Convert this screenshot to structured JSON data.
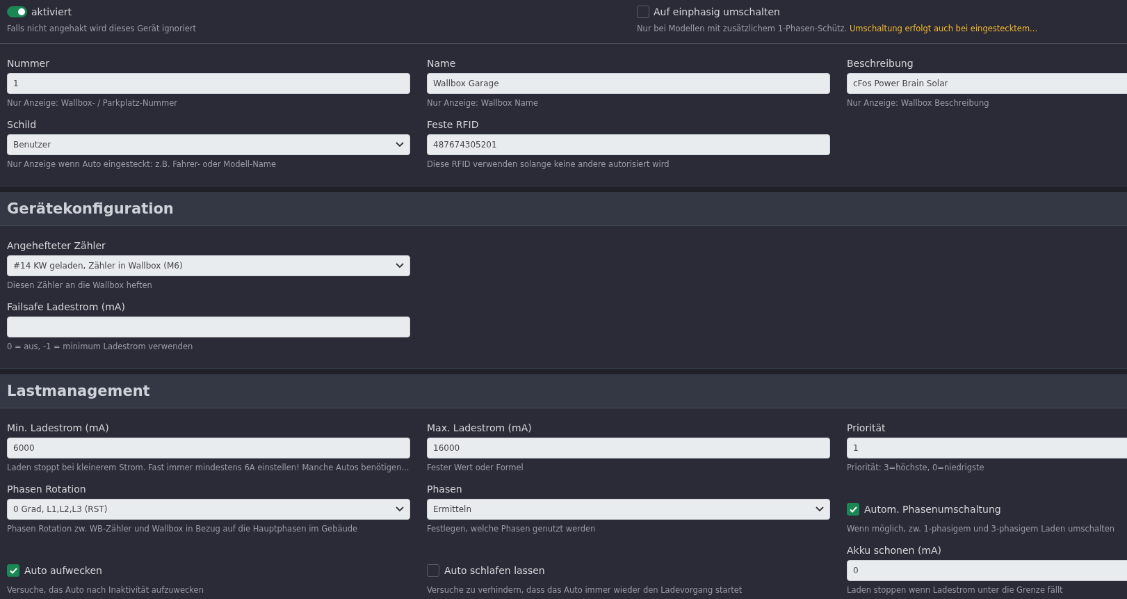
{
  "top_options": [
    {
      "kind": "switch",
      "label": "aktiviert",
      "checked": true,
      "hint": "Falls nicht angehakt wird dieses Gerät ignoriert"
    },
    {
      "kind": "checkbox",
      "label": "Auf einphasig umschalten",
      "checked": false,
      "hint": "Nur bei Modellen mit zusätzlichem 1-Phasen-Schütz.",
      "warning": "Umschaltung erfolgt auch bei eingestecktem..."
    }
  ],
  "general": {
    "rows": [
      [
        {
          "kind": "input",
          "label": "Nummer",
          "value": "1",
          "hint": "Nur Anzeige: Wallbox- / Parkplatz-Nummer"
        },
        {
          "kind": "input",
          "label": "Name",
          "value": "Wallbox Garage",
          "hint": "Nur Anzeige: Wallbox Name"
        },
        {
          "kind": "input",
          "label": "Beschreibung",
          "value": "cFos Power Brain Solar",
          "hint": "Nur Anzeige: Wallbox Beschreibung"
        }
      ],
      [
        {
          "kind": "select",
          "label": "Schild",
          "value": "Benutzer",
          "hint": "Nur Anzeige wenn Auto eingesteckt: z.B. Fahrer- oder Modell-Name"
        },
        {
          "kind": "input",
          "label": "Feste RFID",
          "value": "487674305201",
          "hint": "Diese RFID verwenden solange keine andere autorisiert wird"
        }
      ]
    ]
  },
  "sections": [
    {
      "title": "Gerätekonfiguration",
      "rows": [
        [
          {
            "kind": "select",
            "label": "Angehefteter Zähler",
            "value": "#14 KW geladen, Zähler in Wallbox (M6)",
            "hint": "Diesen Zähler an die Wallbox heften"
          }
        ],
        [
          {
            "kind": "input",
            "label": "Failsafe Ladestrom (mA)",
            "hint": "0 = aus, -1 = minimum Ladestrom verwenden"
          }
        ]
      ]
    },
    {
      "title": "Lastmanagement",
      "rows": [
        [
          {
            "kind": "input",
            "label": "Min. Ladestrom (mA)",
            "value": "6000",
            "hint": "Laden stoppt bei kleinerem Strom. Fast immer mindestens 6A einstellen! Manche Autos benötigen..."
          },
          {
            "kind": "input",
            "label": "Max. Ladestrom (mA)",
            "value": "16000",
            "hint": "Fester Wert oder Formel"
          },
          {
            "kind": "input",
            "label": "Priorität",
            "value": "1",
            "hint": "Priorität: 3=höchste, 0=niedrigste"
          }
        ],
        [
          {
            "kind": "select",
            "label": "Phasen Rotation",
            "value": "0 Grad, L1,L2,L3 (RST)",
            "hint": "Phasen Rotation zw. WB-Zähler und Wallbox in Bezug auf die Hauptphasen im Gebäude"
          },
          {
            "kind": "select",
            "label": "Phasen",
            "value": "Ermitteln",
            "hint": "Festlegen, welche Phasen genutzt werden"
          },
          {
            "kind": "checkbox",
            "label": "Autom. Phasenumschaltung",
            "checked": true,
            "hint": "Wenn möglich, zw. 1-phasigem und 3-phasigem Laden umschalten"
          }
        ],
        [
          {
            "kind": "checkbox",
            "label": "Auto aufwecken",
            "checked": true,
            "hint": "Versuche, das Auto nach Inaktivität aufzuwecken"
          },
          {
            "kind": "checkbox",
            "label": "Auto schlafen lassen",
            "checked": false,
            "hint": "Versuche zu verhindern, dass das Auto immer wieder den Ladevorgang startet"
          },
          {
            "kind": "input",
            "label": "Akku schonen (mA)",
            "value": "0",
            "hint": "Laden stoppen wenn Ladestrom unter die Grenze fällt"
          }
        ]
      ]
    }
  ]
}
